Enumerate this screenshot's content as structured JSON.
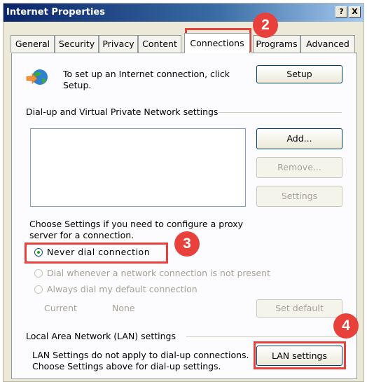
{
  "window": {
    "title": "Internet Properties",
    "help_btn": "?",
    "close_btn": "X"
  },
  "tabs": [
    {
      "label": "General"
    },
    {
      "label": "Security"
    },
    {
      "label": "Privacy"
    },
    {
      "label": "Content"
    },
    {
      "label": "Connections",
      "active": true
    },
    {
      "label": "Programs"
    },
    {
      "label": "Advanced"
    }
  ],
  "setup": {
    "text_line1": "To set up an Internet connection, click",
    "text_line2": "Setup.",
    "button": "Setup",
    "icon": "network-globe-icon"
  },
  "dialup": {
    "group_label": "Dial-up and Virtual Private Network settings",
    "add_button": "Add...",
    "remove_button": "Remove...",
    "settings_button": "Settings"
  },
  "proxy": {
    "text_line1": "Choose Settings if you need to configure a proxy",
    "text_line2": "server for a connection."
  },
  "radios": [
    {
      "label": "Never dial connection",
      "selected": true,
      "enabled": true
    },
    {
      "label": "Dial whenever a network connection is not present",
      "selected": false,
      "enabled": false
    },
    {
      "label": "Always dial my default connection",
      "selected": false,
      "enabled": false
    }
  ],
  "current": {
    "label": "Current",
    "value": "None",
    "set_default_button": "Set default"
  },
  "lan": {
    "group_label": "Local Area Network (LAN) settings",
    "text_line1": "LAN Settings do not apply to dial-up connections.",
    "text_line2": "Choose Settings above for dial-up settings.",
    "button": "LAN settings"
  },
  "annotations": {
    "step2": "2",
    "step3": "3",
    "step4": "4",
    "color": "#e8413b"
  }
}
